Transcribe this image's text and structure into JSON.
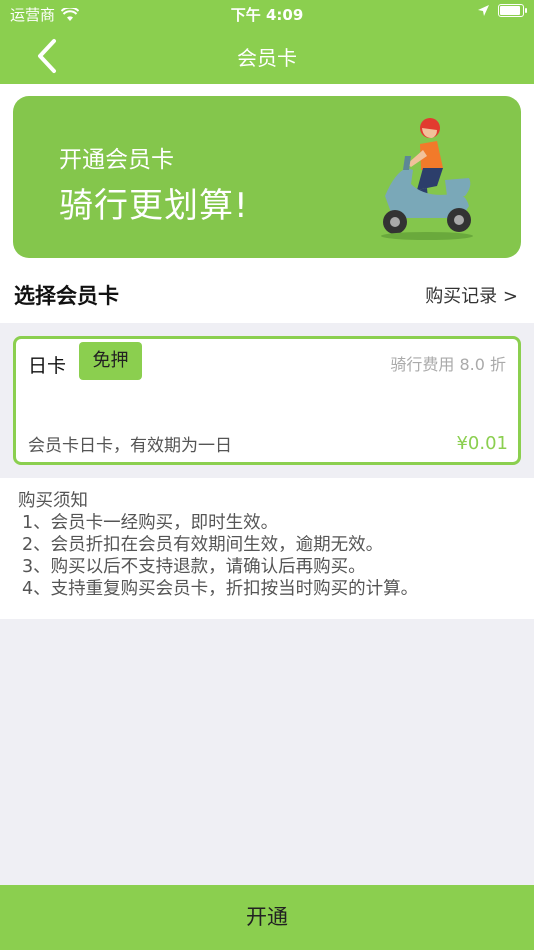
{
  "status_bar": {
    "carrier": "运营商",
    "time": "下午 4:09"
  },
  "nav": {
    "title": "会员卡",
    "back_icon": "chevron-left-icon"
  },
  "banner": {
    "subtitle": "开通会员卡",
    "headline": "骑行更划算!"
  },
  "section": {
    "title": "选择会员卡",
    "history_link": "购买记录 >"
  },
  "card": {
    "name": "日卡",
    "badge": "免押",
    "discount": "骑行费用 8.0 折",
    "description": "会员卡日卡，有效期为一日",
    "price": "¥0.01"
  },
  "notice": {
    "title": "购买须知",
    "items": [
      "1、会员卡一经购买，即时生效。",
      "2、会员折扣在会员有效期间生效，逾期无效。",
      "3、购买以后不支持退款，请确认后再购买。",
      "4、支持重复购买会员卡，折扣按当时购买的计算。"
    ]
  },
  "bottom_button": {
    "label": "开通"
  },
  "colors": {
    "brand_green": "#8bcf4f",
    "banner_green": "#84c64c",
    "background": "#efeff4"
  }
}
